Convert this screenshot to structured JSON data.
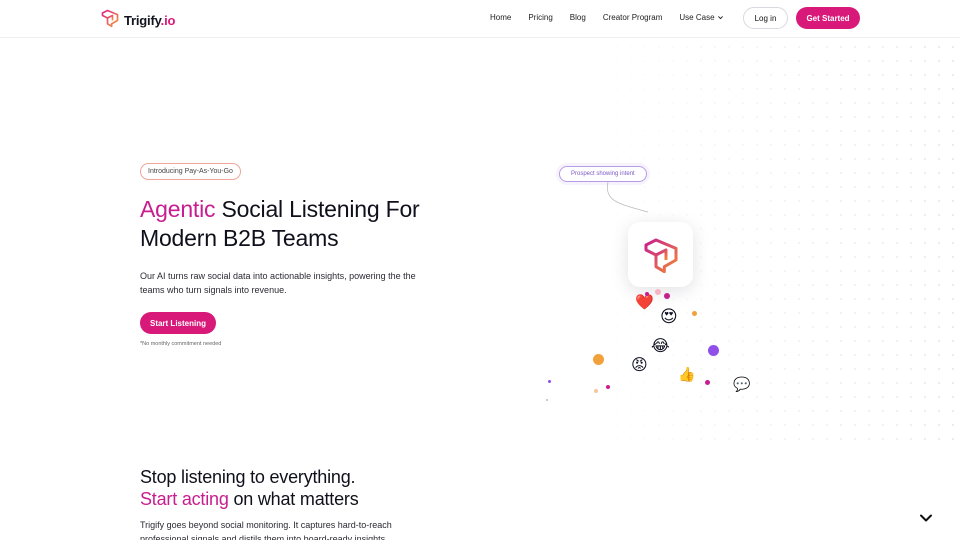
{
  "nav": {
    "logo_text": "Trigify",
    "logo_suffix": ".io",
    "links": [
      "Home",
      "Pricing",
      "Blog",
      "Creator Program",
      "Use Case"
    ],
    "login_label": "Log in",
    "cta_label": "Get Started"
  },
  "hero": {
    "badge": "Introducing Pay-As-You-Go",
    "title_accent": "Agentic",
    "title_rest_1": " Social Listening For",
    "title_line_2": "Modern B2B Teams",
    "description": "Our AI turns raw social data into actionable insights, powering the the teams who turn signals into revenue.",
    "cta_label": "Start Listening",
    "note": "*No monthly commitment needed"
  },
  "illustration": {
    "pill_label": "Prospect showing intent",
    "emojis": {
      "heart": "❤️",
      "heart_eyes": "😍",
      "laughing": "😂",
      "angry": "😡",
      "thumbs_up": "👍",
      "speech": "💬"
    }
  },
  "section2": {
    "title_line_1": "Stop listening to everything.",
    "title_accent": "Start acting",
    "title_rest": " on what matters",
    "description": "Trigify goes beyond social monitoring. It captures hard-to-reach professional signals and distils them into board-ready insights."
  },
  "colors": {
    "brand": "#d9197a",
    "accent_text": "#c81d8f",
    "pill_border": "#b79be6"
  }
}
